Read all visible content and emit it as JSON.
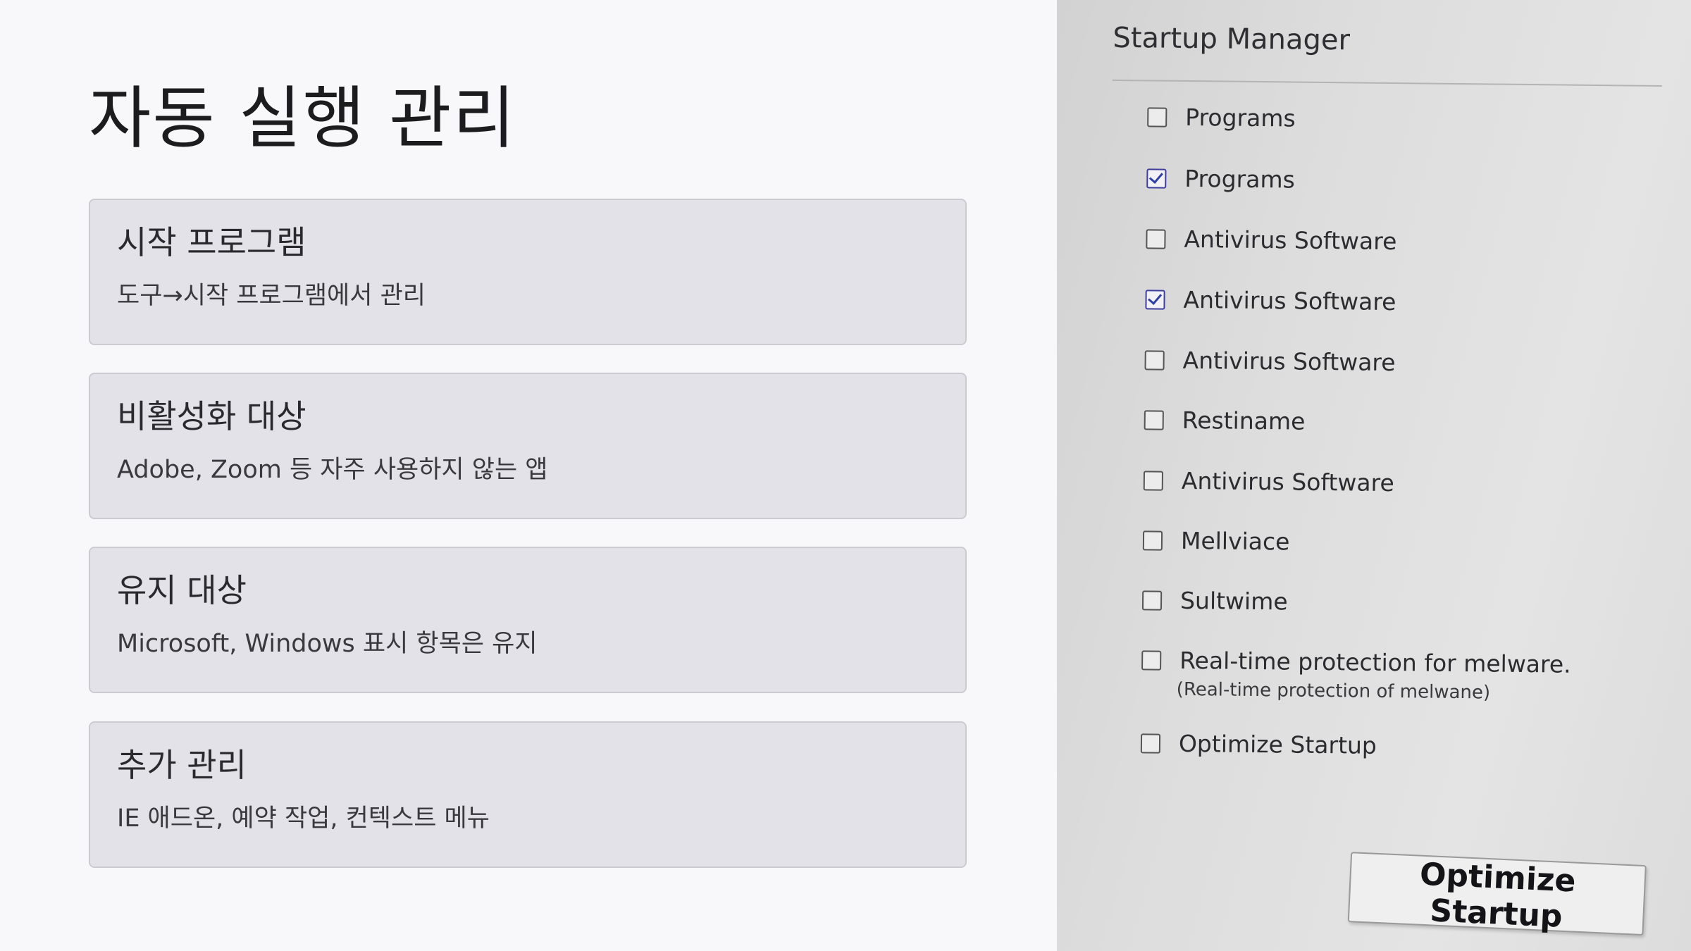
{
  "slide": {
    "title": "자동 실행 관리",
    "cards": [
      {
        "title": "시작 프로그램",
        "desc": "도구→시작 프로그램에서 관리"
      },
      {
        "title": "비활성화 대상",
        "desc": "Adobe, Zoom 등 자주 사용하지 않는 앱"
      },
      {
        "title": "유지 대상",
        "desc": "Microsoft, Windows 표시 항목은 유지"
      },
      {
        "title": "추가 관리",
        "desc": "IE 애드온, 예약 작업, 컨텍스트 메뉴"
      }
    ]
  },
  "startup_manager": {
    "title": "Startup Manager",
    "items": [
      {
        "label": "Programs",
        "checked": false
      },
      {
        "label": "Programs",
        "checked": true
      },
      {
        "label": "Antivirus Software",
        "checked": false
      },
      {
        "label": "Antivirus Software",
        "checked": true
      },
      {
        "label": "Antivirus Software",
        "checked": false
      },
      {
        "label": "Restiname",
        "checked": false
      },
      {
        "label": "Antivirus Software",
        "checked": false
      },
      {
        "label": "Mellviace",
        "checked": false
      },
      {
        "label": "Sultwime",
        "checked": false
      },
      {
        "label": "Real-time protection for melware.",
        "sublabel": "(Real-time protection of melwane)",
        "checked": false
      },
      {
        "label": "Optimize Startup",
        "checked": false
      }
    ],
    "button_label": "Optimize Startup"
  }
}
